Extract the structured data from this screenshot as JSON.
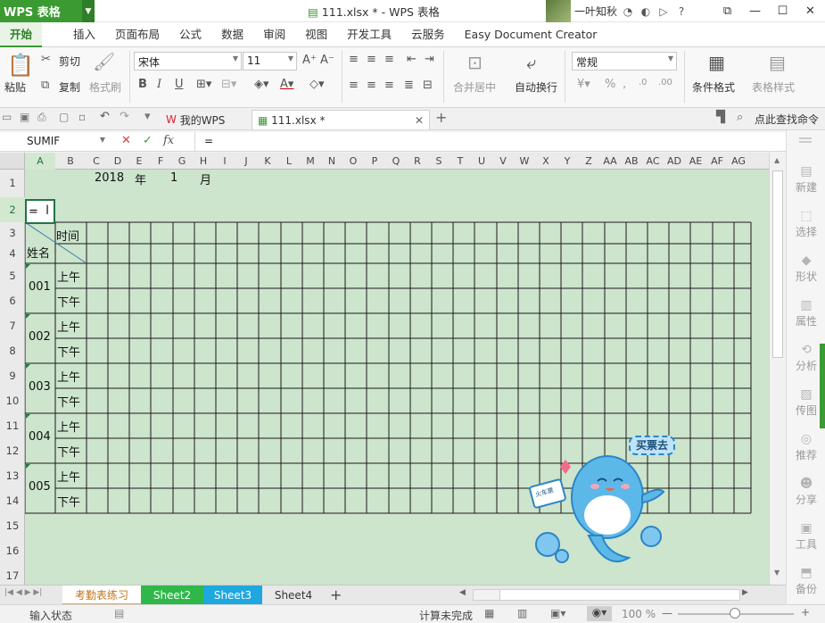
{
  "app": {
    "menu_label": "WPS 表格",
    "window_title": "111.xlsx * - WPS 表格",
    "user_name": "一叶知秋"
  },
  "menu_tabs": [
    "开始",
    "插入",
    "页面布局",
    "公式",
    "数据",
    "审阅",
    "视图",
    "开发工具",
    "云服务",
    "Easy Document Creator"
  ],
  "ribbon": {
    "paste": "粘贴",
    "cut": "剪切",
    "copy": "复制",
    "format_painter": "格式刷",
    "font_name": "宋体",
    "font_size": "11",
    "merge_center": "合并居中",
    "wrap_text": "自动换行",
    "number_format": "常规",
    "conditional_format": "条件格式",
    "table_style": "表格样式"
  },
  "file_tabs": {
    "my_wps": "我的WPS",
    "file_name": "111.xlsx *",
    "search_cmd": "点此查找命令"
  },
  "formula_bar": {
    "name_box": "SUMIF",
    "formula": "="
  },
  "columns": [
    "A",
    "B",
    "C",
    "D",
    "E",
    "F",
    "G",
    "H",
    "I",
    "J",
    "K",
    "L",
    "M",
    "N",
    "O",
    "P",
    "Q",
    "R",
    "S",
    "T",
    "U",
    "V",
    "W",
    "X",
    "Y",
    "Z",
    "AA",
    "AB",
    "AC",
    "AD",
    "AE",
    "AF",
    "AG"
  ],
  "rows": [
    "1",
    "2",
    "3",
    "4",
    "5",
    "6",
    "7",
    "8",
    "9",
    "10",
    "11",
    "12",
    "13",
    "14",
    "15",
    "16",
    "17"
  ],
  "cells": {
    "year": "2018",
    "year_unit": "年",
    "month": "1",
    "month_unit": "月",
    "a2": "=",
    "time_header": "时间",
    "name_header": "姓名",
    "am": "上午",
    "pm": "下午",
    "ids": [
      "001",
      "002",
      "003",
      "004",
      "005"
    ]
  },
  "mascot": {
    "sign": "买票去",
    "ticket": "火车票"
  },
  "side_tools": [
    "新建",
    "选择",
    "形状",
    "属性",
    "分析",
    "传图",
    "推荐",
    "分享",
    "工具",
    "备份"
  ],
  "sheet_tabs": [
    "考勤表练习",
    "Sheet2",
    "Sheet3",
    "Sheet4"
  ],
  "status": {
    "mode": "输入状态",
    "calc": "计算未完成",
    "zoom": "100 %"
  },
  "colors": {
    "wps_green": "#3b9a32",
    "sheet_bg": "#cde4cd",
    "sheet2_tab": "#2fb84a",
    "sheet3_tab": "#1fa8e0"
  }
}
